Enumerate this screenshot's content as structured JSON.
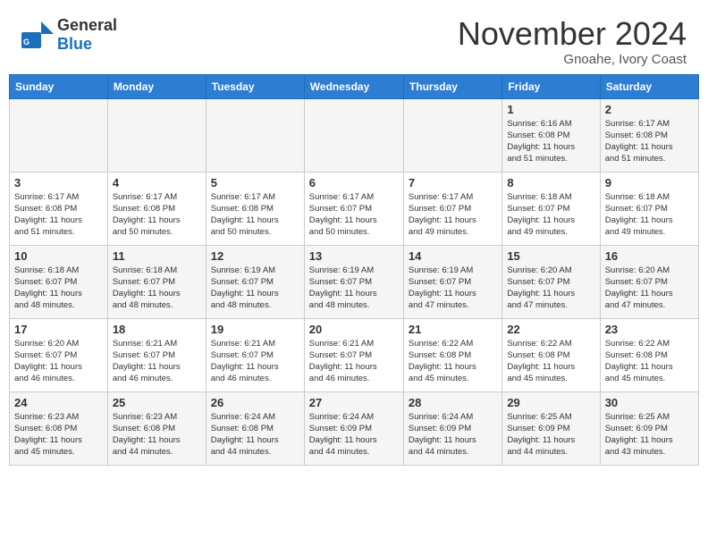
{
  "header": {
    "logo_general": "General",
    "logo_blue": "Blue",
    "month_title": "November 2024",
    "location": "Gnoahe, Ivory Coast"
  },
  "days_of_week": [
    "Sunday",
    "Monday",
    "Tuesday",
    "Wednesday",
    "Thursday",
    "Friday",
    "Saturday"
  ],
  "weeks": [
    {
      "days": [
        {
          "num": "",
          "info": ""
        },
        {
          "num": "",
          "info": ""
        },
        {
          "num": "",
          "info": ""
        },
        {
          "num": "",
          "info": ""
        },
        {
          "num": "",
          "info": ""
        },
        {
          "num": "1",
          "info": "Sunrise: 6:16 AM\nSunset: 6:08 PM\nDaylight: 11 hours\nand 51 minutes."
        },
        {
          "num": "2",
          "info": "Sunrise: 6:17 AM\nSunset: 6:08 PM\nDaylight: 11 hours\nand 51 minutes."
        }
      ]
    },
    {
      "days": [
        {
          "num": "3",
          "info": "Sunrise: 6:17 AM\nSunset: 6:08 PM\nDaylight: 11 hours\nand 51 minutes."
        },
        {
          "num": "4",
          "info": "Sunrise: 6:17 AM\nSunset: 6:08 PM\nDaylight: 11 hours\nand 50 minutes."
        },
        {
          "num": "5",
          "info": "Sunrise: 6:17 AM\nSunset: 6:08 PM\nDaylight: 11 hours\nand 50 minutes."
        },
        {
          "num": "6",
          "info": "Sunrise: 6:17 AM\nSunset: 6:07 PM\nDaylight: 11 hours\nand 50 minutes."
        },
        {
          "num": "7",
          "info": "Sunrise: 6:17 AM\nSunset: 6:07 PM\nDaylight: 11 hours\nand 49 minutes."
        },
        {
          "num": "8",
          "info": "Sunrise: 6:18 AM\nSunset: 6:07 PM\nDaylight: 11 hours\nand 49 minutes."
        },
        {
          "num": "9",
          "info": "Sunrise: 6:18 AM\nSunset: 6:07 PM\nDaylight: 11 hours\nand 49 minutes."
        }
      ]
    },
    {
      "days": [
        {
          "num": "10",
          "info": "Sunrise: 6:18 AM\nSunset: 6:07 PM\nDaylight: 11 hours\nand 48 minutes."
        },
        {
          "num": "11",
          "info": "Sunrise: 6:18 AM\nSunset: 6:07 PM\nDaylight: 11 hours\nand 48 minutes."
        },
        {
          "num": "12",
          "info": "Sunrise: 6:19 AM\nSunset: 6:07 PM\nDaylight: 11 hours\nand 48 minutes."
        },
        {
          "num": "13",
          "info": "Sunrise: 6:19 AM\nSunset: 6:07 PM\nDaylight: 11 hours\nand 48 minutes."
        },
        {
          "num": "14",
          "info": "Sunrise: 6:19 AM\nSunset: 6:07 PM\nDaylight: 11 hours\nand 47 minutes."
        },
        {
          "num": "15",
          "info": "Sunrise: 6:20 AM\nSunset: 6:07 PM\nDaylight: 11 hours\nand 47 minutes."
        },
        {
          "num": "16",
          "info": "Sunrise: 6:20 AM\nSunset: 6:07 PM\nDaylight: 11 hours\nand 47 minutes."
        }
      ]
    },
    {
      "days": [
        {
          "num": "17",
          "info": "Sunrise: 6:20 AM\nSunset: 6:07 PM\nDaylight: 11 hours\nand 46 minutes."
        },
        {
          "num": "18",
          "info": "Sunrise: 6:21 AM\nSunset: 6:07 PM\nDaylight: 11 hours\nand 46 minutes."
        },
        {
          "num": "19",
          "info": "Sunrise: 6:21 AM\nSunset: 6:07 PM\nDaylight: 11 hours\nand 46 minutes."
        },
        {
          "num": "20",
          "info": "Sunrise: 6:21 AM\nSunset: 6:07 PM\nDaylight: 11 hours\nand 46 minutes."
        },
        {
          "num": "21",
          "info": "Sunrise: 6:22 AM\nSunset: 6:08 PM\nDaylight: 11 hours\nand 45 minutes."
        },
        {
          "num": "22",
          "info": "Sunrise: 6:22 AM\nSunset: 6:08 PM\nDaylight: 11 hours\nand 45 minutes."
        },
        {
          "num": "23",
          "info": "Sunrise: 6:22 AM\nSunset: 6:08 PM\nDaylight: 11 hours\nand 45 minutes."
        }
      ]
    },
    {
      "days": [
        {
          "num": "24",
          "info": "Sunrise: 6:23 AM\nSunset: 6:08 PM\nDaylight: 11 hours\nand 45 minutes."
        },
        {
          "num": "25",
          "info": "Sunrise: 6:23 AM\nSunset: 6:08 PM\nDaylight: 11 hours\nand 44 minutes."
        },
        {
          "num": "26",
          "info": "Sunrise: 6:24 AM\nSunset: 6:08 PM\nDaylight: 11 hours\nand 44 minutes."
        },
        {
          "num": "27",
          "info": "Sunrise: 6:24 AM\nSunset: 6:09 PM\nDaylight: 11 hours\nand 44 minutes."
        },
        {
          "num": "28",
          "info": "Sunrise: 6:24 AM\nSunset: 6:09 PM\nDaylight: 11 hours\nand 44 minutes."
        },
        {
          "num": "29",
          "info": "Sunrise: 6:25 AM\nSunset: 6:09 PM\nDaylight: 11 hours\nand 44 minutes."
        },
        {
          "num": "30",
          "info": "Sunrise: 6:25 AM\nSunset: 6:09 PM\nDaylight: 11 hours\nand 43 minutes."
        }
      ]
    }
  ]
}
